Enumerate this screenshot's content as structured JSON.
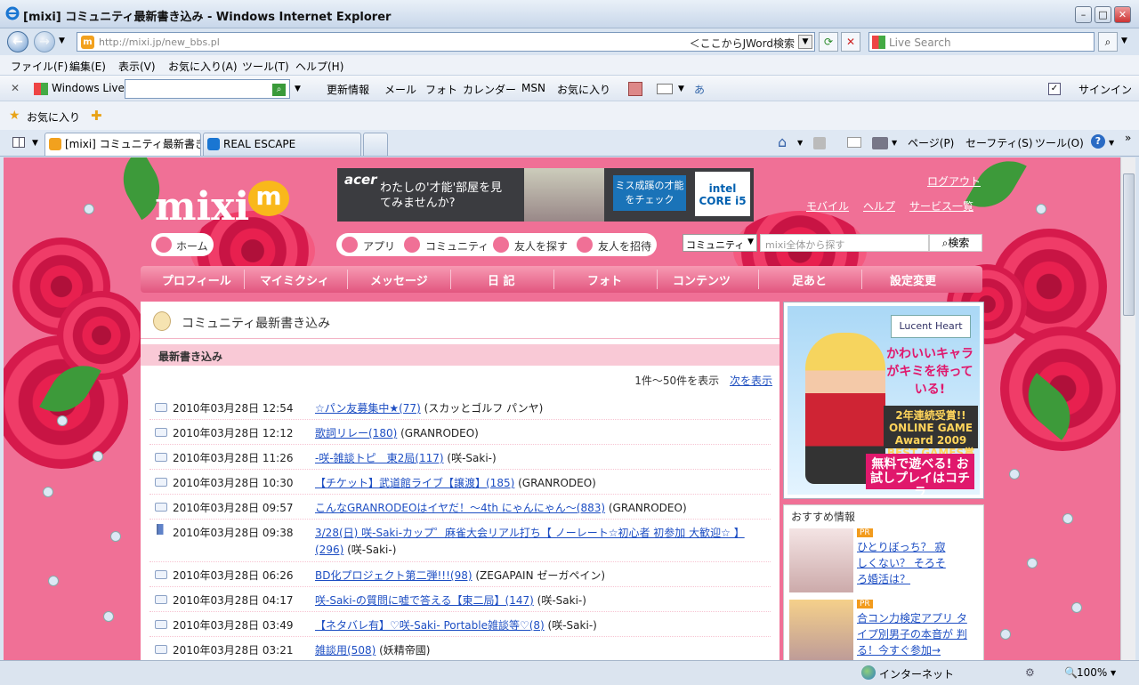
{
  "window": {
    "title": "[mixi] コミュニティ最新書き込み - Windows Internet Explorer",
    "minimize": "–",
    "maximize": "□",
    "close": "✕"
  },
  "address": {
    "url": "http://mixi.jp/new_bbs.pl",
    "jword": "＜ここからJWord検索",
    "search_placeholder": "Live Search"
  },
  "menu": [
    "ファイル(F)",
    "編集(E)",
    "表示(V)",
    "お気に入り(A)",
    "ツール(T)",
    "ヘルプ(H)"
  ],
  "livebar": {
    "brand": "Windows Live",
    "items": [
      "更新情報",
      "メール",
      "フォト",
      "カレンダー",
      "MSN",
      "お気に入り"
    ],
    "signin": "サインイン"
  },
  "favorites": {
    "label": "お気に入り"
  },
  "tabs": [
    {
      "label": "[mixi] コミュニティ最新書き..."
    },
    {
      "label": "REAL ESCAPE"
    }
  ],
  "commands": [
    "ページ(P)",
    "セーフティ(S)",
    "ツール(O)"
  ],
  "status": {
    "zone": "インターネット",
    "zoom": "100%"
  },
  "mixi": {
    "logo": "mixi",
    "logo_mark": "m",
    "logout": "ログアウト",
    "links": [
      "モバイル",
      "ヘルプ",
      "サービス一覧"
    ],
    "ad": {
      "brand": "acer",
      "copy": "わたしの'才能'部屋を見てみませんか?",
      "cta": "ミス成蹊の才能をチェック",
      "intel": "intel CORE i5"
    },
    "home": "ホーム",
    "nav_pills": [
      "アプリ",
      "コミュニティ",
      "友人を探す",
      "友人を招待"
    ],
    "search": {
      "scope": "コミュニティ",
      "placeholder": "mixi全体から探す",
      "button": "検索"
    },
    "gnav": [
      "プロフィール",
      "マイミクシィ",
      "メッセージ",
      "日 記",
      "フォト",
      "コンテンツ",
      "足あと",
      "設定変更"
    ],
    "page_title": "コミュニティ最新書き込み",
    "subhead": "最新書き込み",
    "count": "1件～50件を表示",
    "next": "次を表示",
    "rows": [
      {
        "dt": "2010年03月28日 12:54",
        "title": "☆パン友募集中★(77)",
        "community": " (スカッとゴルフ パンヤ)"
      },
      {
        "dt": "2010年03月28日 12:12",
        "title": "歌詞リレー(180)",
        "community": " (GRANRODEO)"
      },
      {
        "dt": "2010年03月28日 11:26",
        "title": "-咲-雑談トピ　東2局(117)",
        "community": " (咲-Saki-)"
      },
      {
        "dt": "2010年03月28日 10:30",
        "title": "【チケット】武道館ライブ【譲渡】(185)",
        "community": " (GRANRODEO)"
      },
      {
        "dt": "2010年03月28日 09:57",
        "title": "こんなGRANRODEOはイヤだ！～4th にゃんにゃん～(883)",
        "community": " (GRANRODEO)"
      },
      {
        "dt": "2010年03月28日 09:38",
        "title": "3/28(日) 咲-Saki-カップ゜麻雀大会リアル打ち【 ノーレート☆初心者 初参加 大歓迎☆ 】(296)",
        "community": " (咲-Saki-)"
      },
      {
        "dt": "2010年03月28日 06:26",
        "title": "BD化プロジェクト第二弾!!!(98)",
        "community": " (ZEGAPAIN ゼーガペイン)"
      },
      {
        "dt": "2010年03月28日 04:17",
        "title": "咲-Saki-の質問に嘘で答える【東二局】(147)",
        "community": " (咲-Saki-)"
      },
      {
        "dt": "2010年03月28日 03:49",
        "title": "【ネタバレ有】♡咲-Saki- Portable雑談等♡(8)",
        "community": " (咲-Saki-)"
      },
      {
        "dt": "2010年03月28日 03:21",
        "title": "雑談用(508)",
        "community": " (妖精帝國)"
      }
    ],
    "side_ad": {
      "logo": "Lucent Heart",
      "catch": "かわいいキャラがキミを待っている!",
      "award": "2年連続受賞!! ONLINE GAME Award 2009 BEST GAMES賞",
      "free": "無料で遊べる! お試しプレイはコチラ"
    },
    "recommend": {
      "header": "おすすめ情報",
      "items": [
        {
          "badge": "PR",
          "text": "ひとりぼっち？ 寂しくない？ そろそろ婚活は？"
        },
        {
          "badge": "PR",
          "text": "合コン力検定アプリ タイプ別男子の本音が 判る！今すぐ参加→"
        }
      ]
    }
  }
}
